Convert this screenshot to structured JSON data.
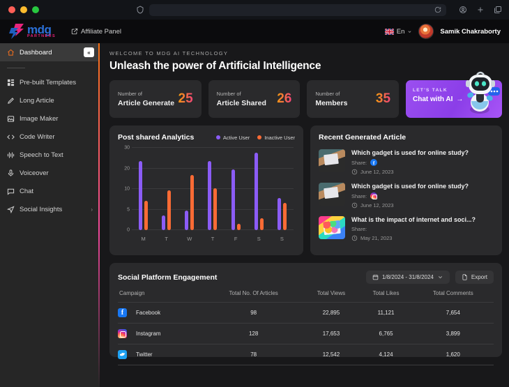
{
  "browser": {
    "url_value": "",
    "url_placeholder": "",
    "icons": [
      "shield-icon",
      "reload-icon",
      "account-icon",
      "new-tab-icon",
      "tabs-icon"
    ]
  },
  "header": {
    "logo_mdg": "mdg",
    "logo_partners": "PARTNERS",
    "affiliate_label": "Affiliate Panel",
    "language": "En",
    "username": "Samik Chakraborty"
  },
  "sidebar": {
    "collapse_label": "«",
    "items": [
      {
        "label": "Dashboard",
        "icon": "home-icon",
        "active": true
      },
      {
        "label": "Pre-built Templates",
        "icon": "grid-icon",
        "active": false
      },
      {
        "label": "Long Article",
        "icon": "pencil-icon",
        "active": false
      },
      {
        "label": "Image Maker",
        "icon": "image-icon",
        "active": false
      },
      {
        "label": "Code Writer",
        "icon": "code-icon",
        "active": false
      },
      {
        "label": "Speech to Text",
        "icon": "waveform-icon",
        "active": false
      },
      {
        "label": "Voiceover",
        "icon": "microphone-icon",
        "active": false
      },
      {
        "label": "Chat",
        "icon": "chat-bubble-icon",
        "active": false
      },
      {
        "label": "Social Insights",
        "icon": "share-icon",
        "active": false,
        "caret": "›"
      }
    ]
  },
  "hero": {
    "welcome": "WELCOME TO MDG AI TECHNOLOGY",
    "headline": "Unleash the power of Artificial Intelligence"
  },
  "stats": [
    {
      "label_small": "Number of",
      "label_large": "Article Generate",
      "value": "25"
    },
    {
      "label_small": "Number of",
      "label_large": "Article Shared",
      "value": "26"
    },
    {
      "label_small": "Number of",
      "label_large": "Members",
      "value": "35"
    }
  ],
  "chat_card": {
    "kicker": "LET'S TALK",
    "title": "Chat with AI",
    "arrow": "→",
    "accent": "#9b4ff0"
  },
  "chart_panel": {
    "title": "Post shared Analytics"
  },
  "chart_data": {
    "type": "bar",
    "title": "Post shared Analytics",
    "xlabel": "",
    "ylabel": "",
    "categories": [
      "M",
      "T",
      "W",
      "T",
      "F",
      "S",
      "S"
    ],
    "yticks": [
      0,
      5,
      10,
      20,
      30
    ],
    "ylim": [
      0,
      30
    ],
    "grid": true,
    "legend_position": "top-right",
    "series": [
      {
        "name": "Active User",
        "color": "#8b5cf6",
        "values": [
          23.5,
          3.5,
          4.8,
          23.5,
          19.5,
          27.5,
          7.8
        ]
      },
      {
        "name": "Inactive User",
        "color": "#fb6b35",
        "values": [
          7.2,
          9.7,
          16.8,
          10.5,
          1.5,
          2.9,
          6.6
        ]
      }
    ]
  },
  "articles_panel": {
    "title": "Recent Generated Article",
    "share_label": "Share:",
    "items": [
      {
        "title": "Which gadget is used for online study?",
        "share_icon": "facebook-icon",
        "date": "June 12, 2023",
        "thumb": "book"
      },
      {
        "title": "Which gadget is used for online study?",
        "share_icon": "instagram-icon",
        "date": "June 12, 2023",
        "thumb": "book"
      },
      {
        "title": "What is the impact of internet and soci...?",
        "share_icon": "none",
        "date": "May 21, 2023",
        "thumb": "tablet"
      }
    ]
  },
  "table_panel": {
    "title": "Social Platform Engagement",
    "date_range": "1/8/2024  -  31/8/2024",
    "export_label": "Export",
    "columns": [
      "Campaign",
      "Total No. Of Articles",
      "Total Views",
      "Total Likes",
      "Total Comments"
    ],
    "rows": [
      {
        "platform": "Facebook",
        "icon": "facebook-icon",
        "articles": "98",
        "views": "22,895",
        "likes": "11,121",
        "comments": "7,654"
      },
      {
        "platform": "Instagram",
        "icon": "instagram-icon",
        "articles": "128",
        "views": "17,653",
        "likes": "6,765",
        "comments": "3,899"
      },
      {
        "platform": "Twitter",
        "icon": "twitter-icon",
        "articles": "78",
        "views": "12,542",
        "likes": "4,124",
        "comments": "1,620"
      }
    ]
  }
}
